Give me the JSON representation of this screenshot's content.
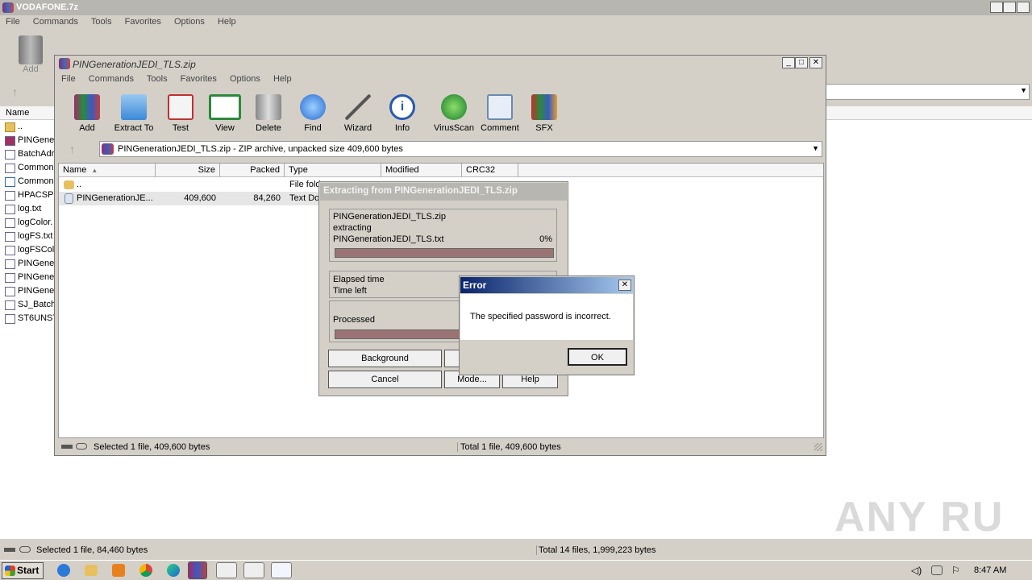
{
  "outer": {
    "title": "VODAFONE.7z",
    "menu": [
      "File",
      "Commands",
      "Tools",
      "Favorites",
      "Options",
      "Help"
    ],
    "add_label": "Add",
    "col_name": "Name",
    "files": [
      "..",
      "PINGene",
      "BatchAdr",
      "Common",
      "Common",
      "HPACSPb",
      "log.txt",
      "logColor.",
      "logFS.txt",
      "logFSCol",
      "PINGene",
      "PINGene",
      "PINGene",
      "SJ_Batch",
      "ST6UNST"
    ],
    "status_left": "Selected 1 file, 84,460 bytes",
    "status_right": "Total 14 files, 1,999,223 bytes"
  },
  "inner": {
    "title": "PINGenerationJEDI_TLS.zip",
    "menu": [
      "File",
      "Commands",
      "Tools",
      "Favorites",
      "Options",
      "Help"
    ],
    "toolbar": [
      "Add",
      "Extract To",
      "Test",
      "View",
      "Delete",
      "Find",
      "Wizard",
      "Info",
      "VirusScan",
      "Comment",
      "SFX"
    ],
    "path": "PINGenerationJEDI_TLS.zip - ZIP archive, unpacked size 409,600 bytes",
    "columns": [
      "Name",
      "Size",
      "Packed",
      "Type",
      "Modified",
      "CRC32"
    ],
    "rows": [
      {
        "name": "..",
        "size": "",
        "packed": "",
        "type": "File fold"
      },
      {
        "name": "PINGenerationJE...",
        "size": "409,600",
        "packed": "84,260",
        "type": "Text Do"
      }
    ],
    "status_left": "Selected 1 file, 409,600 bytes",
    "status_right": "Total 1 file, 409,600 bytes"
  },
  "extract": {
    "title": "Extracting from PINGenerationJEDI_TLS.zip",
    "archive": "PINGenerationJEDI_TLS.zip",
    "action": "extracting",
    "file": "PINGenerationJEDI_TLS.txt",
    "percent": "0%",
    "progress": 0,
    "elapsed_label": "Elapsed time",
    "left_label": "Time left",
    "processed_label": "Processed",
    "btn_background": "Background",
    "btn_cancel": "Cancel",
    "btn_mode": "Mode...",
    "btn_help": "Help"
  },
  "error": {
    "title": "Error",
    "message": "The specified password is incorrect.",
    "ok": "OK"
  },
  "taskbar": {
    "start": "Start",
    "clock": "8:47 AM"
  },
  "watermark": "ANY RUN"
}
